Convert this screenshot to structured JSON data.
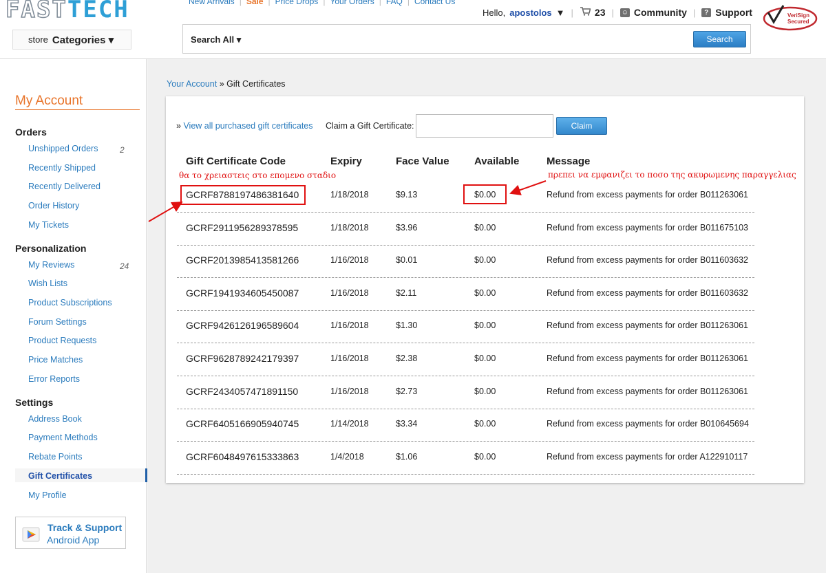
{
  "header": {
    "logo_left": "FAST",
    "logo_right": "TECH",
    "nav": [
      "New Arrivals",
      "Sale",
      "Price Drops",
      "Your Orders",
      "FAQ",
      "Contact Us"
    ],
    "greeting": "Hello,",
    "username": "apostolos",
    "cart_count": "23",
    "community": "Community",
    "support": "Support",
    "store_label": "store",
    "categories_label": "Categories ▾",
    "search_scope": "Search All ▾",
    "search_button": "Search",
    "verisign_line1": "VeriSign",
    "verisign_line2": "Secured"
  },
  "sidebar": {
    "title": "My Account",
    "sections": [
      {
        "title": "Orders",
        "items": [
          {
            "label": "Unshipped Orders",
            "count": "2"
          },
          {
            "label": "Recently Shipped",
            "count": ""
          },
          {
            "label": "Recently Delivered",
            "count": ""
          },
          {
            "label": "Order History",
            "count": ""
          },
          {
            "label": "My Tickets",
            "count": ""
          }
        ]
      },
      {
        "title": "Personalization",
        "items": [
          {
            "label": "My Reviews",
            "count": "24"
          },
          {
            "label": "Wish Lists",
            "count": ""
          },
          {
            "label": "Product Subscriptions",
            "count": ""
          },
          {
            "label": "Forum Settings",
            "count": ""
          },
          {
            "label": "Product Requests",
            "count": ""
          },
          {
            "label": "Price Matches",
            "count": ""
          },
          {
            "label": "Error Reports",
            "count": ""
          }
        ]
      },
      {
        "title": "Settings",
        "items": [
          {
            "label": "Address Book",
            "count": ""
          },
          {
            "label": "Payment Methods",
            "count": ""
          },
          {
            "label": "Rebate Points",
            "count": ""
          },
          {
            "label": "Gift Certificates",
            "count": "",
            "active": true
          },
          {
            "label": "My Profile",
            "count": ""
          }
        ]
      }
    ],
    "app_line1": "Track & Support",
    "app_line2": "Android App"
  },
  "main": {
    "breadcrumb_link": "Your Account",
    "breadcrumb_sep": " » ",
    "breadcrumb_current": "Gift Certificates",
    "view_all_prefix": "» ",
    "view_all": "View all purchased gift certificates",
    "claim_label": "Claim a Gift Certificate:",
    "claim_value": "",
    "claim_button": "Claim",
    "columns": [
      "Gift Certificate Code",
      "Expiry",
      "Face Value",
      "Available",
      "Message"
    ],
    "rows": [
      {
        "code": "GCRF8788197486381640",
        "expiry": "1/18/2018",
        "face": "$9.13",
        "available": "$0.00",
        "message": "Refund from excess payments for order B011263061"
      },
      {
        "code": "GCRF2911956289378595",
        "expiry": "1/18/2018",
        "face": "$3.96",
        "available": "$0.00",
        "message": "Refund from excess payments for order B011675103"
      },
      {
        "code": "GCRF2013985413581266",
        "expiry": "1/16/2018",
        "face": "$0.01",
        "available": "$0.00",
        "message": "Refund from excess payments for order B011603632"
      },
      {
        "code": "GCRF1941934605450087",
        "expiry": "1/16/2018",
        "face": "$2.11",
        "available": "$0.00",
        "message": "Refund from excess payments for order B011603632"
      },
      {
        "code": "GCRF9426126196589604",
        "expiry": "1/16/2018",
        "face": "$1.30",
        "available": "$0.00",
        "message": "Refund from excess payments for order B011263061"
      },
      {
        "code": "GCRF9628789242179397",
        "expiry": "1/16/2018",
        "face": "$2.38",
        "available": "$0.00",
        "message": "Refund from excess payments for order B011263061"
      },
      {
        "code": "GCRF2434057471891150",
        "expiry": "1/16/2018",
        "face": "$2.73",
        "available": "$0.00",
        "message": "Refund from excess payments for order B011263061"
      },
      {
        "code": "GCRF6405166905940745",
        "expiry": "1/14/2018",
        "face": "$3.34",
        "available": "$0.00",
        "message": "Refund from excess payments for order B010645694"
      },
      {
        "code": "GCRF6048497615333863",
        "expiry": "1/4/2018",
        "face": "$1.06",
        "available": "$0.00",
        "message": "Refund from excess payments for order A122910117"
      }
    ]
  },
  "annotations": {
    "note_code": "θα το χρειαστεις στο επομενο σταδιο",
    "note_available": "πρεπει να εμφανιζει το ποσο της ακυρωμενης παραγγελιας",
    "color": "#e01010"
  }
}
